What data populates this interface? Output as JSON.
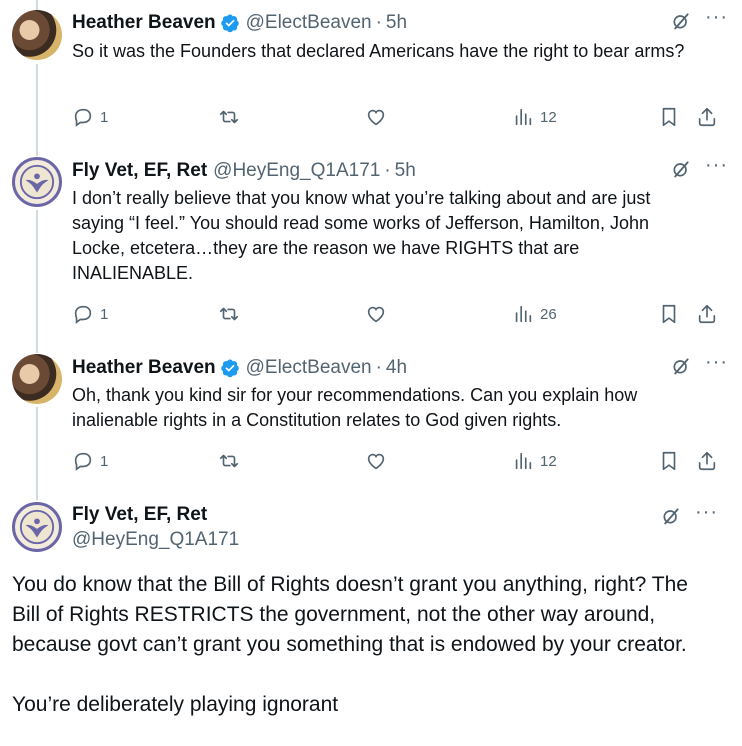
{
  "replies": [
    {
      "name": "Heather Beaven",
      "verified": true,
      "handle": "@ElectBeaven",
      "time": "5h",
      "text": "So it was the Founders that declared Americans have the right to bear arms?",
      "replies_count": "1",
      "views": "12",
      "avatar": "heather-avatar"
    },
    {
      "name": "Fly Vet, EF, Ret",
      "verified": false,
      "handle": "@HeyEng_Q1A171",
      "time": "5h",
      "text_lines": [
        "I don’t really believe that you know what you’re talking about and are just",
        "saying “I feel.” You should read some works of Jefferson, Hamilton, John",
        "Locke, etcetera…they are the reason we have RIGHTS that are",
        "INALIENABLE."
      ],
      "replies_count": "1",
      "views": "26",
      "avatar": "flyvet-avatar"
    },
    {
      "name": "Heather Beaven",
      "verified": true,
      "handle": "@ElectBeaven",
      "time": "4h",
      "text_lines": [
        "Oh, thank you kind sir for your recommendations. Can you explain how",
        "inalienable rights in a Constitution relates to God given rights."
      ],
      "replies_count": "1",
      "views": "12",
      "avatar": "heather-avatar"
    }
  ],
  "main": {
    "name": "Fly Vet, EF, Ret",
    "handle": "@HeyEng_Q1A171",
    "paragraph1_lines": [
      "You do know that the Bill of Rights doesn’t grant you anything, right? The",
      "Bill of Rights RESTRICTS the government, not the other way around,",
      "because govt can’t grant you something that is endowed by your creator."
    ],
    "paragraph2": "You’re deliberately playing ignorant"
  },
  "separator": "·",
  "more_label": "···",
  "colors": {
    "accent": "#1d9bf0",
    "muted": "#536471",
    "thread": "#cfd9de"
  }
}
